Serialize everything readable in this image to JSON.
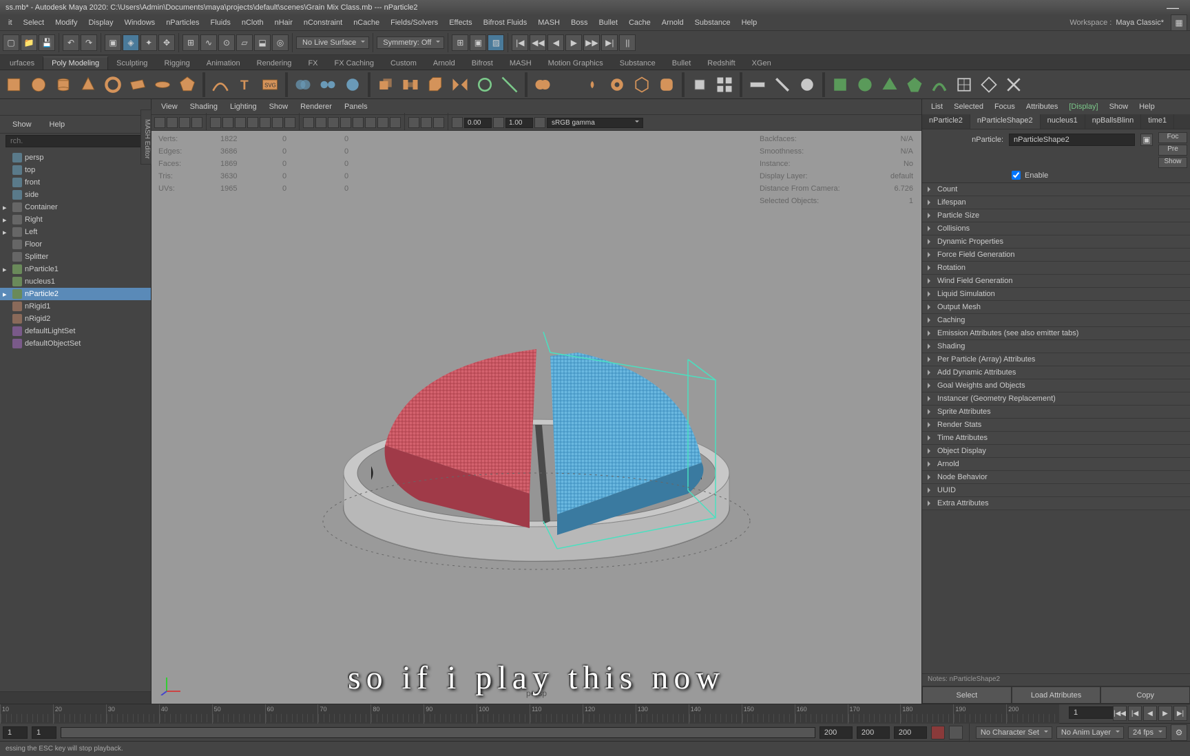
{
  "titlebar": {
    "text": "ss.mb* - Autodesk Maya 2020: C:\\Users\\Admin\\Documents\\maya\\projects\\default\\scenes\\Grain Mix Class.mb --- nParticle2"
  },
  "menubar": {
    "items": [
      "it",
      "Select",
      "Modify",
      "Display",
      "Windows",
      "nParticles",
      "Fluids",
      "nCloth",
      "nHair",
      "nConstraint",
      "nCache",
      "Fields/Solvers",
      "Effects",
      "Bifrost Fluids",
      "MASH",
      "Boss",
      "Bullet",
      "Cache",
      "Arnold",
      "Substance",
      "Help"
    ],
    "workspace_label": "Workspace :",
    "workspace_value": "Maya Classic*"
  },
  "top_toolbar": {
    "live_surface": "No Live Surface",
    "symmetry": "Symmetry: Off"
  },
  "module_tabs": [
    "urfaces",
    "Poly Modeling",
    "Sculpting",
    "Rigging",
    "Animation",
    "Rendering",
    "FX",
    "FX Caching",
    "Custom",
    "Arnold",
    "Bifrost",
    "MASH",
    "Motion Graphics",
    "Substance",
    "Bullet",
    "Redshift",
    "XGen"
  ],
  "module_active_idx": 1,
  "outliner": {
    "show": "Show",
    "help": "Help",
    "search_placeholder": "rch.",
    "items": [
      {
        "label": "persp",
        "icon": "cam"
      },
      {
        "label": "top",
        "icon": "cam"
      },
      {
        "label": "front",
        "icon": "cam"
      },
      {
        "label": "side",
        "icon": "cam"
      },
      {
        "label": "Container",
        "icon": "mesh",
        "arrow": true
      },
      {
        "label": "Right",
        "icon": "mesh",
        "arrow": true
      },
      {
        "label": "Left",
        "icon": "mesh",
        "arrow": true
      },
      {
        "label": "Floor",
        "icon": "mesh"
      },
      {
        "label": "Splitter",
        "icon": "mesh"
      },
      {
        "label": "nParticle1",
        "icon": "particle",
        "arrow": true
      },
      {
        "label": "nucleus1",
        "icon": "particle"
      },
      {
        "label": "nParticle2",
        "icon": "particle",
        "arrow": true,
        "selected": true
      },
      {
        "label": "nRigid1",
        "icon": "rigid"
      },
      {
        "label": "nRigid2",
        "icon": "rigid"
      },
      {
        "label": "defaultLightSet",
        "icon": "set"
      },
      {
        "label": "defaultObjectSet",
        "icon": "set"
      }
    ]
  },
  "viewport": {
    "side_tab": "MASH Editor",
    "menus": [
      "View",
      "Shading",
      "Lighting",
      "Show",
      "Renderer",
      "Panels"
    ],
    "val_0_00": "0.00",
    "val_1_00": "1.00",
    "gamma": "sRGB gamma",
    "persp_label": "persp",
    "hud_left": [
      {
        "lbl": "Verts:",
        "v1": "1822",
        "v2": "0",
        "v3": "0"
      },
      {
        "lbl": "Edges:",
        "v1": "3686",
        "v2": "0",
        "v3": "0"
      },
      {
        "lbl": "Faces:",
        "v1": "1869",
        "v2": "0",
        "v3": "0"
      },
      {
        "lbl": "Tris:",
        "v1": "3630",
        "v2": "0",
        "v3": "0"
      },
      {
        "lbl": "UVs:",
        "v1": "1965",
        "v2": "0",
        "v3": "0"
      }
    ],
    "hud_right": [
      {
        "lbl": "Backfaces:",
        "v": "N/A"
      },
      {
        "lbl": "Smoothness:",
        "v": "N/A"
      },
      {
        "lbl": "Instance:",
        "v": "No"
      },
      {
        "lbl": "Display Layer:",
        "v": "default"
      },
      {
        "lbl": "Distance From Camera:",
        "v": "6.726"
      },
      {
        "lbl": "Selected Objects:",
        "v": "1"
      }
    ]
  },
  "caption": "so if i play this now",
  "attr_editor": {
    "top_menus": [
      "List",
      "Selected",
      "Focus",
      "Attributes",
      "[Display]",
      "Show",
      "Help"
    ],
    "tabs": [
      "nParticle2",
      "nParticleShape2",
      "nucleus1",
      "npBallsBlinn",
      "time1"
    ],
    "active_tab": 1,
    "name_lbl": "nParticle:",
    "name_val": "nParticleShape2",
    "btns": {
      "foc": "Foc",
      "pre": "Pre",
      "show": "Show"
    },
    "enable_lbl": "Enable",
    "sections": [
      "Count",
      "Lifespan",
      "Particle Size",
      "Collisions",
      "Dynamic Properties",
      "Force Field Generation",
      "Rotation",
      "Wind Field Generation",
      "Liquid Simulation",
      "Output Mesh",
      "Caching",
      "Emission Attributes (see also emitter tabs)",
      "Shading",
      "Per Particle (Array) Attributes",
      "Add Dynamic Attributes",
      "Goal Weights and Objects",
      "Instancer (Geometry Replacement)",
      "Sprite Attributes",
      "Render Stats",
      "Time Attributes",
      "Object Display",
      "Arnold",
      "Node Behavior",
      "UUID",
      "Extra Attributes"
    ],
    "notes": "Notes: nParticleShape2",
    "bottom_btns": [
      "Select",
      "Load Attributes",
      "Copy"
    ]
  },
  "timeline": {
    "ticks": [
      "10",
      "20",
      "30",
      "40",
      "50",
      "60",
      "70",
      "80",
      "90",
      "100",
      "110",
      "120",
      "130",
      "140",
      "150",
      "160",
      "170",
      "180",
      "190",
      "200"
    ],
    "current": "1"
  },
  "range": {
    "start": "1",
    "inner_start": "1",
    "inner_end": "200",
    "end": "200",
    "end2": "200",
    "char_set": "No Character Set",
    "anim_layer": "No Anim Layer",
    "fps": "24 fps"
  },
  "statusbar": {
    "msg": "essing the ESC key will stop playback."
  }
}
